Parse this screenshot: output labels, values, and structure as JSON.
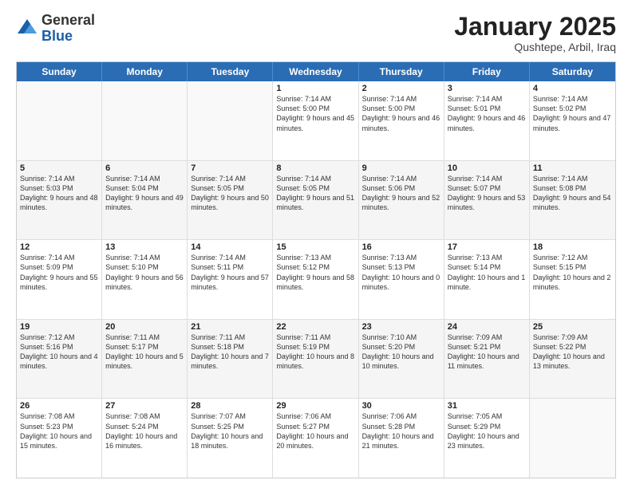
{
  "logo": {
    "general": "General",
    "blue": "Blue"
  },
  "title": {
    "month": "January 2025",
    "location": "Qushtepe, Arbil, Iraq"
  },
  "weekdays": [
    "Sunday",
    "Monday",
    "Tuesday",
    "Wednesday",
    "Thursday",
    "Friday",
    "Saturday"
  ],
  "weeks": [
    [
      {
        "day": "",
        "sunrise": "",
        "sunset": "",
        "daylight": "",
        "empty": true
      },
      {
        "day": "",
        "sunrise": "",
        "sunset": "",
        "daylight": "",
        "empty": true
      },
      {
        "day": "",
        "sunrise": "",
        "sunset": "",
        "daylight": "",
        "empty": true
      },
      {
        "day": "1",
        "sunrise": "Sunrise: 7:14 AM",
        "sunset": "Sunset: 5:00 PM",
        "daylight": "Daylight: 9 hours and 45 minutes.",
        "empty": false
      },
      {
        "day": "2",
        "sunrise": "Sunrise: 7:14 AM",
        "sunset": "Sunset: 5:00 PM",
        "daylight": "Daylight: 9 hours and 46 minutes.",
        "empty": false
      },
      {
        "day": "3",
        "sunrise": "Sunrise: 7:14 AM",
        "sunset": "Sunset: 5:01 PM",
        "daylight": "Daylight: 9 hours and 46 minutes.",
        "empty": false
      },
      {
        "day": "4",
        "sunrise": "Sunrise: 7:14 AM",
        "sunset": "Sunset: 5:02 PM",
        "daylight": "Daylight: 9 hours and 47 minutes.",
        "empty": false
      }
    ],
    [
      {
        "day": "5",
        "sunrise": "Sunrise: 7:14 AM",
        "sunset": "Sunset: 5:03 PM",
        "daylight": "Daylight: 9 hours and 48 minutes.",
        "empty": false
      },
      {
        "day": "6",
        "sunrise": "Sunrise: 7:14 AM",
        "sunset": "Sunset: 5:04 PM",
        "daylight": "Daylight: 9 hours and 49 minutes.",
        "empty": false
      },
      {
        "day": "7",
        "sunrise": "Sunrise: 7:14 AM",
        "sunset": "Sunset: 5:05 PM",
        "daylight": "Daylight: 9 hours and 50 minutes.",
        "empty": false
      },
      {
        "day": "8",
        "sunrise": "Sunrise: 7:14 AM",
        "sunset": "Sunset: 5:05 PM",
        "daylight": "Daylight: 9 hours and 51 minutes.",
        "empty": false
      },
      {
        "day": "9",
        "sunrise": "Sunrise: 7:14 AM",
        "sunset": "Sunset: 5:06 PM",
        "daylight": "Daylight: 9 hours and 52 minutes.",
        "empty": false
      },
      {
        "day": "10",
        "sunrise": "Sunrise: 7:14 AM",
        "sunset": "Sunset: 5:07 PM",
        "daylight": "Daylight: 9 hours and 53 minutes.",
        "empty": false
      },
      {
        "day": "11",
        "sunrise": "Sunrise: 7:14 AM",
        "sunset": "Sunset: 5:08 PM",
        "daylight": "Daylight: 9 hours and 54 minutes.",
        "empty": false
      }
    ],
    [
      {
        "day": "12",
        "sunrise": "Sunrise: 7:14 AM",
        "sunset": "Sunset: 5:09 PM",
        "daylight": "Daylight: 9 hours and 55 minutes.",
        "empty": false
      },
      {
        "day": "13",
        "sunrise": "Sunrise: 7:14 AM",
        "sunset": "Sunset: 5:10 PM",
        "daylight": "Daylight: 9 hours and 56 minutes.",
        "empty": false
      },
      {
        "day": "14",
        "sunrise": "Sunrise: 7:14 AM",
        "sunset": "Sunset: 5:11 PM",
        "daylight": "Daylight: 9 hours and 57 minutes.",
        "empty": false
      },
      {
        "day": "15",
        "sunrise": "Sunrise: 7:13 AM",
        "sunset": "Sunset: 5:12 PM",
        "daylight": "Daylight: 9 hours and 58 minutes.",
        "empty": false
      },
      {
        "day": "16",
        "sunrise": "Sunrise: 7:13 AM",
        "sunset": "Sunset: 5:13 PM",
        "daylight": "Daylight: 10 hours and 0 minutes.",
        "empty": false
      },
      {
        "day": "17",
        "sunrise": "Sunrise: 7:13 AM",
        "sunset": "Sunset: 5:14 PM",
        "daylight": "Daylight: 10 hours and 1 minute.",
        "empty": false
      },
      {
        "day": "18",
        "sunrise": "Sunrise: 7:12 AM",
        "sunset": "Sunset: 5:15 PM",
        "daylight": "Daylight: 10 hours and 2 minutes.",
        "empty": false
      }
    ],
    [
      {
        "day": "19",
        "sunrise": "Sunrise: 7:12 AM",
        "sunset": "Sunset: 5:16 PM",
        "daylight": "Daylight: 10 hours and 4 minutes.",
        "empty": false
      },
      {
        "day": "20",
        "sunrise": "Sunrise: 7:11 AM",
        "sunset": "Sunset: 5:17 PM",
        "daylight": "Daylight: 10 hours and 5 minutes.",
        "empty": false
      },
      {
        "day": "21",
        "sunrise": "Sunrise: 7:11 AM",
        "sunset": "Sunset: 5:18 PM",
        "daylight": "Daylight: 10 hours and 7 minutes.",
        "empty": false
      },
      {
        "day": "22",
        "sunrise": "Sunrise: 7:11 AM",
        "sunset": "Sunset: 5:19 PM",
        "daylight": "Daylight: 10 hours and 8 minutes.",
        "empty": false
      },
      {
        "day": "23",
        "sunrise": "Sunrise: 7:10 AM",
        "sunset": "Sunset: 5:20 PM",
        "daylight": "Daylight: 10 hours and 10 minutes.",
        "empty": false
      },
      {
        "day": "24",
        "sunrise": "Sunrise: 7:09 AM",
        "sunset": "Sunset: 5:21 PM",
        "daylight": "Daylight: 10 hours and 11 minutes.",
        "empty": false
      },
      {
        "day": "25",
        "sunrise": "Sunrise: 7:09 AM",
        "sunset": "Sunset: 5:22 PM",
        "daylight": "Daylight: 10 hours and 13 minutes.",
        "empty": false
      }
    ],
    [
      {
        "day": "26",
        "sunrise": "Sunrise: 7:08 AM",
        "sunset": "Sunset: 5:23 PM",
        "daylight": "Daylight: 10 hours and 15 minutes.",
        "empty": false
      },
      {
        "day": "27",
        "sunrise": "Sunrise: 7:08 AM",
        "sunset": "Sunset: 5:24 PM",
        "daylight": "Daylight: 10 hours and 16 minutes.",
        "empty": false
      },
      {
        "day": "28",
        "sunrise": "Sunrise: 7:07 AM",
        "sunset": "Sunset: 5:25 PM",
        "daylight": "Daylight: 10 hours and 18 minutes.",
        "empty": false
      },
      {
        "day": "29",
        "sunrise": "Sunrise: 7:06 AM",
        "sunset": "Sunset: 5:27 PM",
        "daylight": "Daylight: 10 hours and 20 minutes.",
        "empty": false
      },
      {
        "day": "30",
        "sunrise": "Sunrise: 7:06 AM",
        "sunset": "Sunset: 5:28 PM",
        "daylight": "Daylight: 10 hours and 21 minutes.",
        "empty": false
      },
      {
        "day": "31",
        "sunrise": "Sunrise: 7:05 AM",
        "sunset": "Sunset: 5:29 PM",
        "daylight": "Daylight: 10 hours and 23 minutes.",
        "empty": false
      },
      {
        "day": "",
        "sunrise": "",
        "sunset": "",
        "daylight": "",
        "empty": true
      }
    ]
  ]
}
